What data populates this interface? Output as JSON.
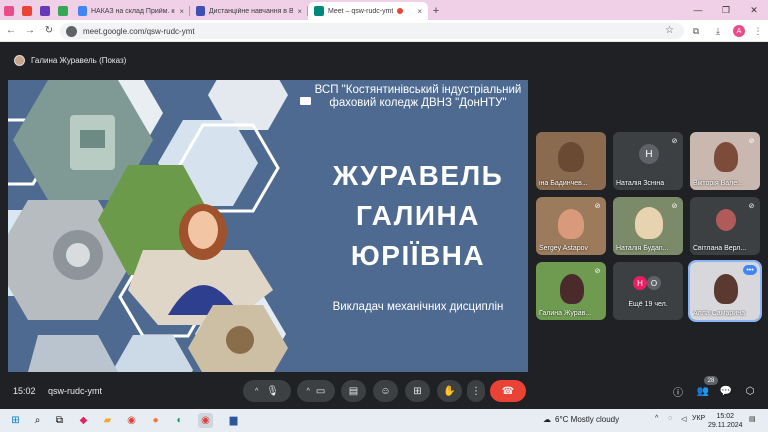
{
  "tabs": [
    {
      "label": "НАКАЗ на склад Прийм. комі",
      "favicon_color": "#4285f4"
    },
    {
      "label": "Дистанційне навчання в ВСП",
      "favicon_color": "#3f51b5"
    },
    {
      "label": "Meet – qsw-rudc-ymt",
      "favicon_color": "#00897b"
    }
  ],
  "address": {
    "url": "meet.google.com/qsw-rudc-ymt"
  },
  "profile_initial": "A",
  "presenter": {
    "label": "Галина Журавель (Показ)"
  },
  "slide": {
    "title": "ВСП \"Костянтинівський індустріальний фаховий коледж ДВНЗ \"ДонНТУ\"",
    "name_line1": "ЖУРАВЕЛЬ",
    "name_line2": "ГАЛИНА",
    "name_line3": "ЮРІЇВНА",
    "role": "Викладач механічних дисциплін"
  },
  "participants": [
    {
      "name": "іна Бадинчев...",
      "type": "video"
    },
    {
      "name": "Наталія Зсніна",
      "type": "letter",
      "letter": "Н"
    },
    {
      "name": "Вікторія Вале...",
      "type": "video"
    },
    {
      "name": "Sergey Astapov",
      "type": "video"
    },
    {
      "name": "Наталія Будап...",
      "type": "video"
    },
    {
      "name": "Світлана Верл...",
      "type": "video"
    },
    {
      "name": "Галина Журав...",
      "type": "video"
    },
    {
      "name": "Ещё 19 чел.",
      "type": "more",
      "letters": [
        "Н",
        "О"
      ]
    },
    {
      "name": "Алла Самарина",
      "type": "video"
    }
  ],
  "controls": {
    "time": "15:02",
    "meeting_code": "qsw-rudc-ymt",
    "participant_count": "28"
  },
  "taskbar": {
    "weather": "6°C  Mostly cloudy",
    "lang": "УКР",
    "clock_time": "15:02",
    "clock_date": "29.11.2024"
  },
  "colors": {
    "slide_bg": "#4e6a91",
    "end_call": "#ea4335",
    "accent": "#8ab4f8"
  }
}
